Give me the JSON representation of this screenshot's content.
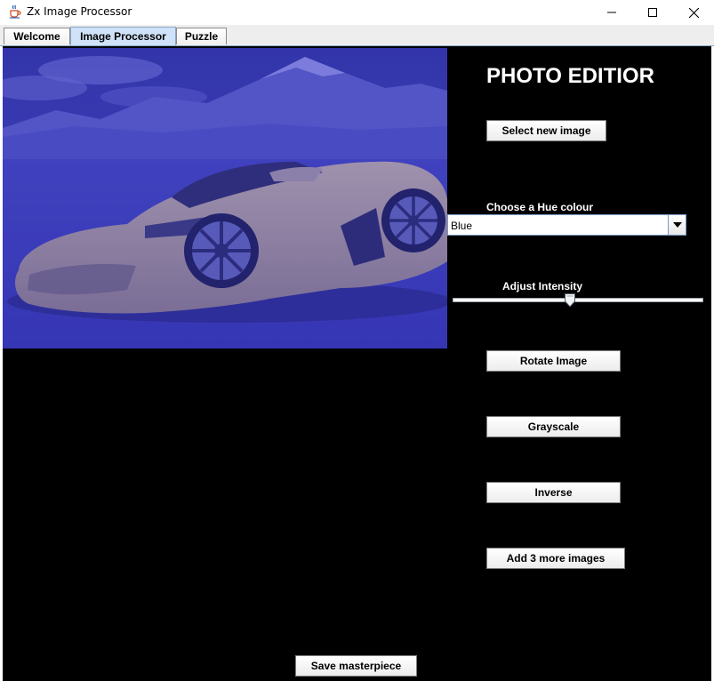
{
  "window": {
    "title": "Zx Image Processor",
    "app_icon": "java-cup-icon",
    "controls": [
      "minimize-icon",
      "maximize-icon",
      "close-icon"
    ]
  },
  "tabs": [
    {
      "label": "Welcome",
      "active": false
    },
    {
      "label": "Image Processor",
      "active": true
    },
    {
      "label": "Puzzle",
      "active": false
    }
  ],
  "editor": {
    "heading": "PHOTO EDITIOR",
    "select_image_label": "Select new image",
    "hue_label": "Choose a Hue colour",
    "hue_value": "Blue",
    "intensity_label": "Adjust Intensity",
    "intensity_fraction": 0.47,
    "rotate_label": "Rotate Image",
    "grayscale_label": "Grayscale",
    "inverse_label": "Inverse",
    "add_images_label": "Add 3 more images",
    "save_label": "Save masterpiece"
  },
  "preview": {
    "description": "photo of a sports car tinted blue",
    "tint_color": "#3a3ac8"
  },
  "colors": {
    "panel_background": "#000000",
    "heading_text": "#ffffff",
    "active_tab": "#cfe2f7"
  }
}
